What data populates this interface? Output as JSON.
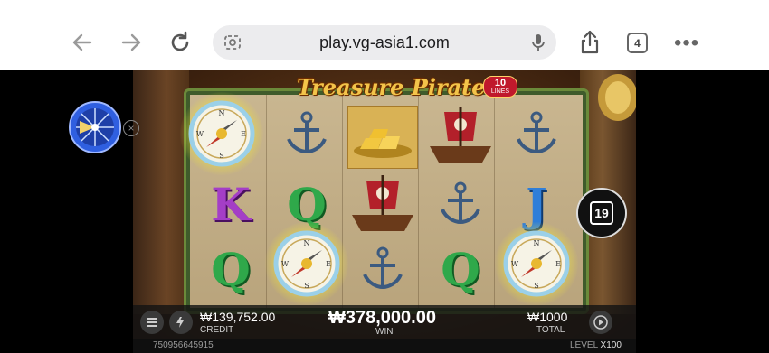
{
  "browser": {
    "url": "play.vg-asia1.com",
    "tab_count": "4",
    "more": "•••"
  },
  "game": {
    "logo_title": "Treasure Pirate",
    "lines_count": "10",
    "lines_label": "LINES",
    "reels": [
      [
        "compass",
        "K",
        "Q"
      ],
      [
        "anchor",
        "Q",
        "compass"
      ],
      [
        "gold",
        "ship",
        "anchor"
      ],
      [
        "ship",
        "anchor",
        "Q"
      ],
      [
        "anchor",
        "J",
        "compass"
      ]
    ],
    "free_spins_remaining": "19",
    "credit_value": "₩139,752.00",
    "credit_label": "CREDIT",
    "win_value": "₩378,000.00",
    "win_label": "WIN",
    "total_value": "₩1000",
    "total_label": "TOTAL",
    "round_id": "750956645915",
    "level_label": "LEVEL",
    "level_value": "X100"
  },
  "colors": {
    "accent_gold": "#f3c44a",
    "compass_glow": "#f0e63c",
    "wheel_blue": "#2f5fe0"
  }
}
